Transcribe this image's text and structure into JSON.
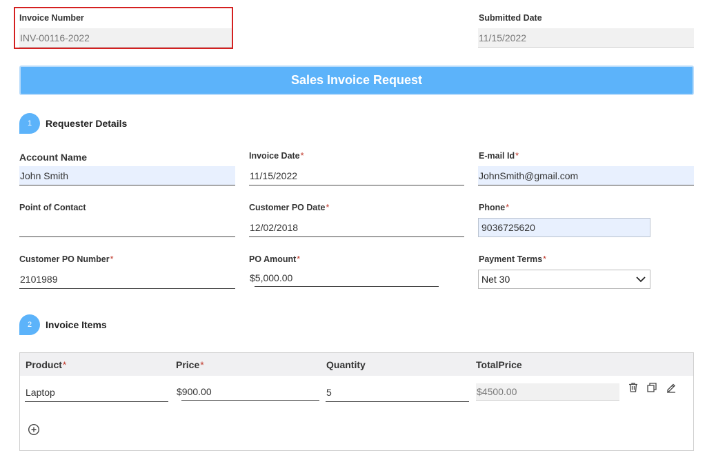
{
  "header": {
    "invoice_number_label": "Invoice Number",
    "invoice_number_value": "INV-00116-2022",
    "submitted_date_label": "Submitted Date",
    "submitted_date_value": "11/15/2022"
  },
  "banner": {
    "title": "Sales Invoice Request"
  },
  "section1": {
    "number": "1",
    "title": "Requester Details",
    "fields": {
      "account_name": {
        "label": "Account Name",
        "value": "John Smith"
      },
      "invoice_date": {
        "label": "Invoice Date",
        "value": "11/15/2022"
      },
      "email": {
        "label": "E-mail Id",
        "value": "JohnSmith@gmail.com"
      },
      "point_of_contact": {
        "label": "Point of Contact",
        "value": ""
      },
      "customer_po_date": {
        "label": "Customer PO Date",
        "value": "12/02/2018"
      },
      "phone": {
        "label": "Phone",
        "value": "9036725620"
      },
      "customer_po_number": {
        "label": "Customer PO Number",
        "value": "2101989"
      },
      "po_amount": {
        "label": "PO Amount",
        "value": "$5,000.00"
      },
      "payment_terms": {
        "label": "Payment Terms",
        "value": "Net 30"
      }
    },
    "required_marker": "*"
  },
  "section2": {
    "number": "2",
    "title": "Invoice Items",
    "columns": [
      "Product",
      "Price",
      "Quantity",
      "TotalPrice"
    ],
    "rows": [
      {
        "product": "Laptop",
        "price": "$900.00",
        "quantity": "5",
        "total": "$4500.00"
      }
    ]
  },
  "icons": {
    "delete": "trash-icon",
    "duplicate": "copy-icon",
    "edit": "pencil-icon",
    "add": "plus-circle-icon",
    "dropdown": "chevron-down-icon"
  },
  "colors": {
    "accent": "#5cb3fa",
    "highlight": "#d42020",
    "required": "#c0392b",
    "autofill": "#e8f0fe"
  }
}
